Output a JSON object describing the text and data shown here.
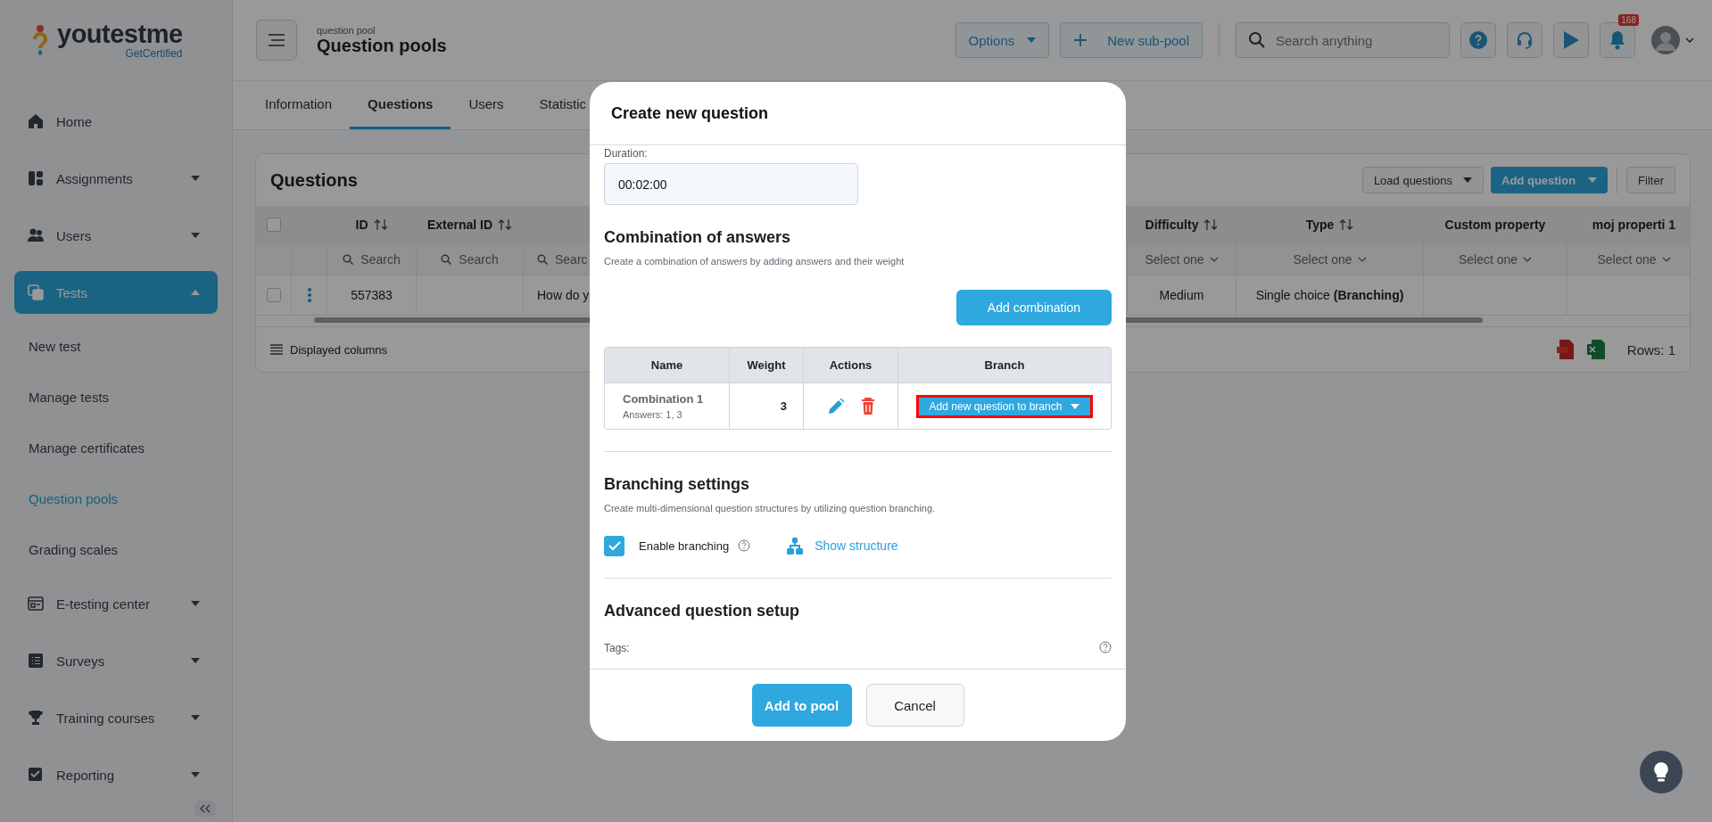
{
  "logo": {
    "name": "youtestme",
    "tagline": "GetCertified"
  },
  "sidebar": {
    "items": [
      {
        "label": "Home",
        "kind": "link",
        "selected": false
      },
      {
        "label": "Assignments",
        "kind": "group",
        "expanded": false,
        "selected": false
      },
      {
        "label": "Users",
        "kind": "group",
        "expanded": false,
        "selected": false
      },
      {
        "label": "Tests",
        "kind": "group",
        "expanded": true,
        "selected": true,
        "children": [
          {
            "label": "New test",
            "selected": false
          },
          {
            "label": "Manage tests",
            "selected": false
          },
          {
            "label": "Manage certificates",
            "selected": false
          },
          {
            "label": "Question pools",
            "selected": true
          },
          {
            "label": "Grading scales",
            "selected": false
          }
        ]
      },
      {
        "label": "E-testing center",
        "kind": "group",
        "expanded": false,
        "selected": false
      },
      {
        "label": "Surveys",
        "kind": "group",
        "expanded": false,
        "selected": false
      },
      {
        "label": "Training courses",
        "kind": "group",
        "expanded": false,
        "selected": false
      },
      {
        "label": "Reporting",
        "kind": "group",
        "expanded": false,
        "selected": false
      }
    ]
  },
  "header": {
    "breadcrumb": "question pool",
    "title": "Question pools",
    "options_button": "Options",
    "new_button": "New sub-pool",
    "search": {
      "placeholder": "Search anything"
    },
    "notification_count": "168"
  },
  "tabs": [
    {
      "label": "Information",
      "selected": false
    },
    {
      "label": "Questions",
      "selected": true
    },
    {
      "label": "Users",
      "selected": false
    },
    {
      "label": "Statistic",
      "selected": false
    }
  ],
  "questions": {
    "title": "Questions",
    "buttons": {
      "load": "Load questions",
      "add": "Add question",
      "filter": "Filter"
    },
    "select_all": {
      "checked": false
    },
    "columns": [
      {
        "label": "ID",
        "sortable": true
      },
      {
        "label": "External ID",
        "sortable": true
      },
      {},
      {
        "label": "Difficulty",
        "sortable": true
      },
      {
        "label": "Type",
        "sortable": true
      },
      {
        "label": "Custom property",
        "sortable": false
      },
      {
        "label": "moj properti 1",
        "sortable": false
      }
    ],
    "filters": [
      {
        "kind": "search",
        "text": "Search"
      },
      {
        "kind": "search",
        "text": "Search"
      },
      {
        "kind": "search",
        "text": "Searc"
      },
      {
        "kind": "select",
        "text": "Select one"
      },
      {
        "kind": "select",
        "text": "Select one"
      },
      {
        "kind": "select",
        "text": "Select one"
      },
      {
        "kind": "select",
        "text": "Select one"
      }
    ],
    "rows": [
      {
        "checked": false,
        "cells": [
          "557383",
          "",
          "How do y",
          "Medium",
          "Single choice **(Branching)**",
          "",
          ""
        ]
      }
    ],
    "displayed_columns": "Displayed columns",
    "rows_count": "Rows: 1"
  },
  "dialog": {
    "title": "Create new question",
    "duration_label": "Duration:",
    "duration_value": "00:02:00",
    "combination": {
      "title": "Combination of answers",
      "description": "Create a combination of answers by adding answers and their weight",
      "add_button": "Add combination",
      "columns": [
        "Name",
        "Weight",
        "Actions",
        "Branch"
      ],
      "rows": [
        {
          "name": "Combination 1",
          "answers": "Answers: 1, 3",
          "weight": "3",
          "branch_button": "Add new question to branch",
          "highlighted": true
        }
      ]
    },
    "branching": {
      "title": "Branching settings",
      "description": "Create multi-dimensional question structures by utilizing question branching.",
      "enable_label": "Enable branching",
      "enabled": true,
      "structure_link": "Show structure"
    },
    "advanced": {
      "title": "Advanced question setup",
      "tags_label": "Tags:"
    },
    "buttons": {
      "primary": "Add to pool",
      "cancel": "Cancel"
    }
  }
}
